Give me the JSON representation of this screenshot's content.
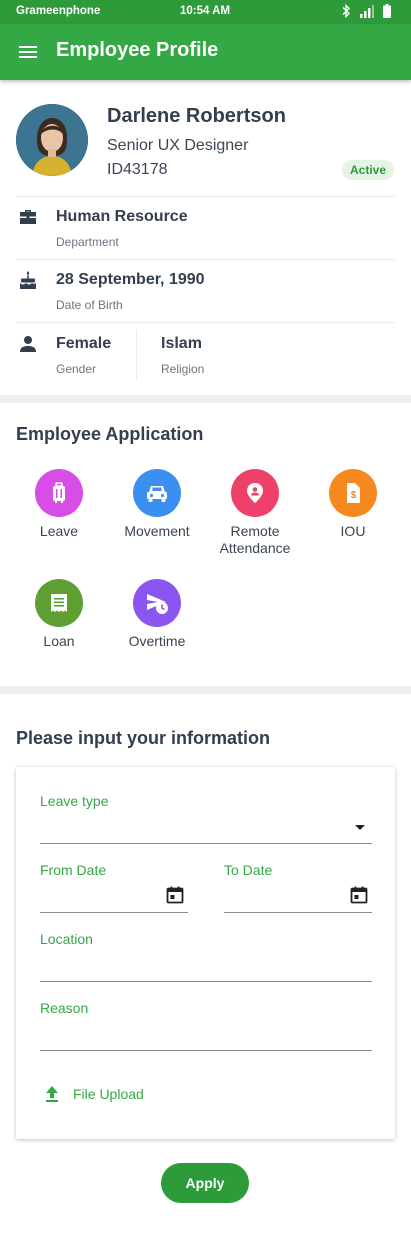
{
  "status_bar": {
    "carrier": "Grameenphone",
    "time": "10:54 AM"
  },
  "app_bar": {
    "title": "Employee Profile",
    "menu_icon": "hamburger-menu-icon"
  },
  "profile": {
    "name": "Darlene Robertson",
    "role": "Senior UX Designer",
    "id": "ID43178",
    "status": "Active",
    "status_color": "#2e9b3b"
  },
  "info": {
    "department": {
      "value": "Human Resource",
      "label": "Department",
      "icon": "briefcase-icon"
    },
    "dob": {
      "value": "28 September, 1990",
      "label": "Date of Birth",
      "icon": "cake-icon"
    },
    "gender": {
      "value": "Female",
      "label": "Gender",
      "icon": "person-icon"
    },
    "religion": {
      "value": "Islam",
      "label": "Religion"
    }
  },
  "applications": {
    "title": "Employee Application",
    "items": [
      {
        "label": "Leave",
        "color": "#d64ee6",
        "icon": "luggage-icon"
      },
      {
        "label": "Movement",
        "color": "#3b8ff0",
        "icon": "car-icon"
      },
      {
        "label": "Remote\nAttendance",
        "color": "#ee4169",
        "icon": "location-person-icon"
      },
      {
        "label": "IOU",
        "color": "#f5891f",
        "icon": "money-document-icon"
      },
      {
        "label": "Loan",
        "color": "#5e9f32",
        "icon": "receipt-icon"
      },
      {
        "label": "Overtime",
        "color": "#8b56f0",
        "icon": "send-clock-icon"
      }
    ]
  },
  "form": {
    "title": "Please input your information",
    "leave_type_label": "Leave type",
    "from_date_label": "From Date",
    "to_date_label": "To Date",
    "location_label": "Location",
    "reason_label": "Reason",
    "file_upload_label": "File Upload",
    "accent_color": "#35a846"
  },
  "apply_label": "Apply"
}
